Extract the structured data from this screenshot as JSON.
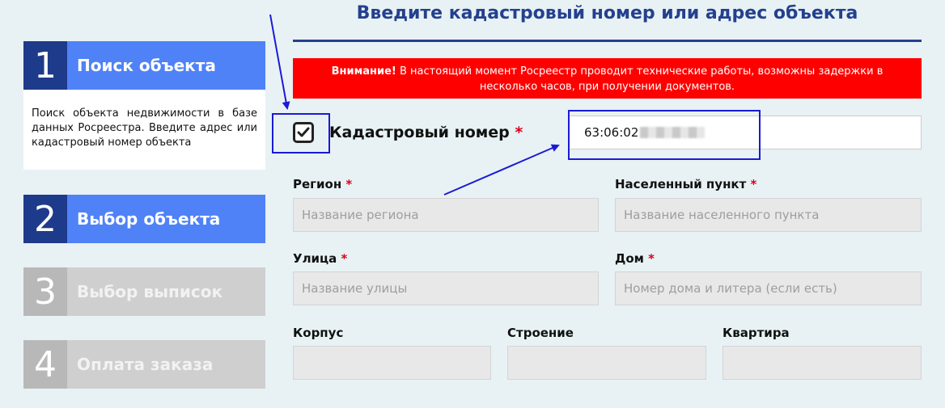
{
  "steps": [
    {
      "num": "1",
      "label": "Поиск объекта",
      "state": "active"
    },
    {
      "num": "2",
      "label": "Выбор объекта",
      "state": "active"
    },
    {
      "num": "3",
      "label": "Выбор выписок",
      "state": "inactive"
    },
    {
      "num": "4",
      "label": "Оплата заказа",
      "state": "inactive"
    }
  ],
  "step1_description": "Поиск объекта недвижимости в базе данных Росреестра. Введите адрес или кадастровый номер объекта",
  "main": {
    "title": "Введите кадастровый номер или адрес объекта",
    "alert_strong": "Внимание!",
    "alert_text": " В настоящий момент Росреестр проводит технические работы, возможны задержки в несколько часов, при получении документов.",
    "cadastral_label": "Кадастровый номер",
    "required_mark": "*",
    "cadastral_value": "63:06:02",
    "cadastral_checked": true
  },
  "fields": {
    "region": {
      "label": "Регион",
      "placeholder": "Название региона",
      "required": true
    },
    "locality": {
      "label": "Населенный пункт",
      "placeholder": "Название населенного пункта",
      "required": true
    },
    "street": {
      "label": "Улица",
      "placeholder": "Название улицы",
      "required": true
    },
    "house": {
      "label": "Дом",
      "placeholder": "Номер дома и литера (если есть)",
      "required": true
    },
    "building": {
      "label": "Корпус",
      "placeholder": "",
      "required": false
    },
    "structure": {
      "label": "Строение",
      "placeholder": "",
      "required": false
    },
    "apartment": {
      "label": "Квартира",
      "placeholder": "",
      "required": false
    }
  },
  "colors": {
    "step_active_num": "#1e3a8a",
    "step_active_label": "#4f82f7",
    "step_inactive": "#cfcfcf",
    "title": "#24408e",
    "alert_bg": "#ff0000",
    "required": "#d9001b",
    "annotation": "#1a1ad6"
  }
}
